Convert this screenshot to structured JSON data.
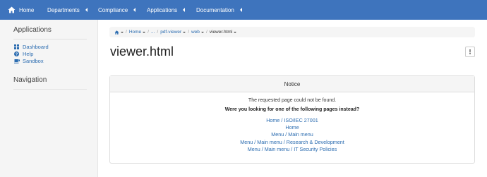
{
  "topnav": {
    "home": "Home",
    "items": [
      "Departments",
      "Compliance",
      "Applications",
      "Documentation"
    ]
  },
  "sidebar": {
    "applications_heading": "Applications",
    "links": [
      {
        "label": "Dashboard",
        "icon": "dashboard-icon"
      },
      {
        "label": "Help",
        "icon": "help-icon"
      },
      {
        "label": "Sandbox",
        "icon": "sandbox-icon"
      }
    ],
    "navigation_heading": "Navigation"
  },
  "breadcrumb": {
    "items": [
      "Home",
      "...",
      "pdf-viewer",
      "web"
    ],
    "current": "viewer.html"
  },
  "page": {
    "title": "viewer.html"
  },
  "notice": {
    "heading": "Notice",
    "message": "The requested page could not be found.",
    "question": "Were you looking for one of the following pages instead?",
    "suggestions": [
      "Home / ISO/IEC 27001",
      "Home",
      "Menu / Main menu",
      "Menu / Main menu / Research & Development",
      "Menu / Main menu / IT Security Policies"
    ]
  },
  "colors": {
    "topbar": "#3e74bd",
    "link": "#2b6cb0",
    "sidebar_bg": "#f5f5f5"
  }
}
